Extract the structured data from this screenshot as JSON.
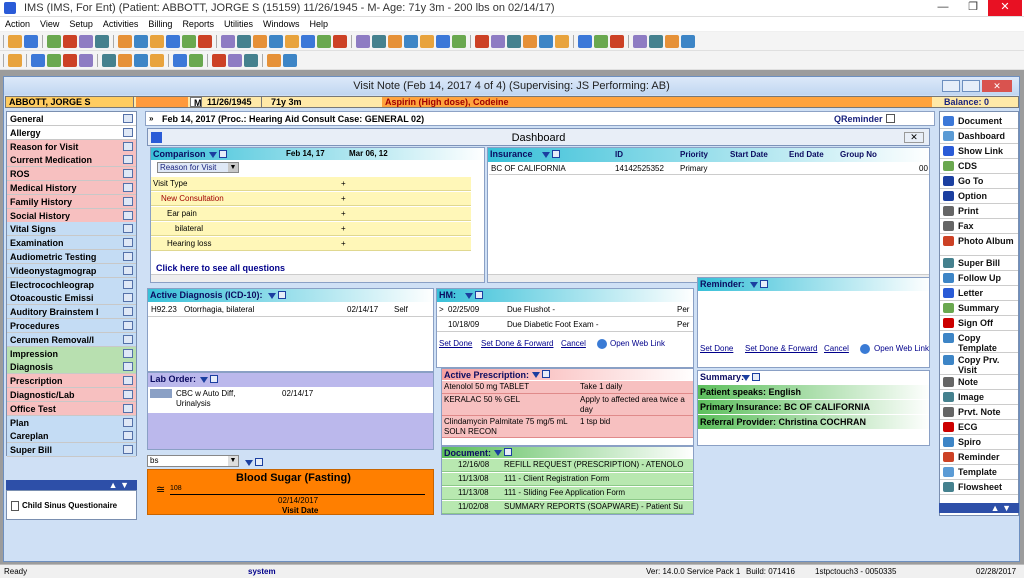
{
  "window": {
    "title": "IMS (IMS, For Ent)    (Patient: ABBOTT, JORGE S (15159) 11/26/1945 - M- Age: 71y 3m  - 200 lbs on 02/14/17)"
  },
  "menu": [
    "Action",
    "View",
    "Setup",
    "Activities",
    "Billing",
    "Reports",
    "Utilities",
    "Windows",
    "Help"
  ],
  "child": {
    "title": "Visit Note (Feb 14, 2017   4 of 4) (Supervising: JS Performing: AB)"
  },
  "patient": {
    "name": "ABBOTT, JORGE S",
    "sex": "M",
    "dob": "11/26/1945",
    "age": "71y 3m",
    "allergies": "Aspirin (High dose), Codeine",
    "balance": "Balance: 0"
  },
  "visit_bar": {
    "text": "Feb 14, 2017  (Proc.: Hearing Aid Consult  Case: GENERAL 02)",
    "qreminder": "QReminder"
  },
  "dashboard": {
    "title": "Dashboard"
  },
  "nav": [
    {
      "label": "General",
      "color": "#ffffff"
    },
    {
      "label": "Allergy",
      "color": "#ffffff"
    },
    {
      "label": "Reason for Visit",
      "color": "#f7c0c0"
    },
    {
      "label": "Current Medication",
      "color": "#f7c0c0"
    },
    {
      "label": "ROS",
      "color": "#f7c0c0"
    },
    {
      "label": "Medical History",
      "color": "#f7c0c0"
    },
    {
      "label": "Family History",
      "color": "#f7c0c0"
    },
    {
      "label": "Social History",
      "color": "#f7c0c0"
    },
    {
      "label": "Vital Signs",
      "color": "#c4dcf4"
    },
    {
      "label": "Examination",
      "color": "#c4dcf4"
    },
    {
      "label": "Audiometric Testing",
      "color": "#c4dcf4"
    },
    {
      "label": "Videonystagmograp",
      "color": "#c4dcf4"
    },
    {
      "label": "Electrocochleograp",
      "color": "#c4dcf4"
    },
    {
      "label": "Otoacoustic Emissi",
      "color": "#c4dcf4"
    },
    {
      "label": "Auditory Brainstem I",
      "color": "#c4dcf4"
    },
    {
      "label": "Procedures",
      "color": "#c4dcf4"
    },
    {
      "label": "Cerumen Removal/I",
      "color": "#c4dcf4"
    },
    {
      "label": "Impression",
      "color": "#b8e0b0"
    },
    {
      "label": "Diagnosis",
      "color": "#b8e0b0"
    },
    {
      "label": "Prescription",
      "color": "#f7c0c0"
    },
    {
      "label": "Diagnostic/Lab",
      "color": "#f7c0c0"
    },
    {
      "label": "Office Test",
      "color": "#f7c0c0"
    },
    {
      "label": "Plan",
      "color": "#c4dcf4"
    },
    {
      "label": "Careplan",
      "color": "#c4dcf4"
    },
    {
      "label": "Super Bill",
      "color": "#c4dcf4"
    }
  ],
  "questionnaire": "Child Sinus Questionaire",
  "right_nav": [
    {
      "label": "Document",
      "icon": "document-icon"
    },
    {
      "label": "Dashboard",
      "icon": "dashboard-icon"
    },
    {
      "label": "Show Link",
      "icon": "link-icon"
    },
    {
      "label": "CDS",
      "icon": "cds-icon"
    },
    {
      "label": "Go To",
      "icon": "goto-icon"
    },
    {
      "label": "Option",
      "icon": "option-icon"
    },
    {
      "label": "Print",
      "icon": "print-icon"
    },
    {
      "label": "Fax",
      "icon": "fax-icon"
    },
    {
      "label": "Photo Album",
      "icon": "photo-icon"
    },
    {
      "label": "Super Bill",
      "icon": "superbill-icon"
    },
    {
      "label": "Follow Up",
      "icon": "followup-icon"
    },
    {
      "label": "Letter",
      "icon": "letter-icon"
    },
    {
      "label": "Summary",
      "icon": "summary-icon"
    },
    {
      "label": "Sign Off",
      "icon": "signoff-icon"
    },
    {
      "label": "Copy Template",
      "icon": "copy-icon"
    },
    {
      "label": "Copy Prv. Visit",
      "icon": "copy-visit-icon"
    },
    {
      "label": "Note",
      "icon": "note-icon"
    },
    {
      "label": "Image",
      "icon": "image-icon"
    },
    {
      "label": "Prvt. Note",
      "icon": "private-note-icon"
    },
    {
      "label": "ECG",
      "icon": "ecg-icon"
    },
    {
      "label": "Spiro",
      "icon": "spiro-icon"
    },
    {
      "label": "Reminder",
      "icon": "reminder-icon"
    },
    {
      "label": "Template",
      "icon": "template-icon"
    },
    {
      "label": "Flowsheet",
      "icon": "flowsheet-icon"
    }
  ],
  "comparison": {
    "header": "Comparison",
    "col1": "Feb 14, 17",
    "col2": "Mar 06, 12",
    "select": "Reason for Visit",
    "rows": [
      {
        "label": "Visit Type",
        "v1": "+"
      },
      {
        "label": "New Consultation",
        "v1": "+"
      },
      {
        "label": "Ear pain",
        "v1": "+"
      },
      {
        "label": "bilateral",
        "v1": "+"
      },
      {
        "label": "Hearing loss",
        "v1": "+"
      }
    ],
    "see_all": "Click here to see all questions"
  },
  "insurance": {
    "headers": [
      "Insurance",
      "ID",
      "Priority",
      "Start Date",
      "End Date",
      "Group No"
    ],
    "row": [
      "BC OF CALIFORNIA",
      "14142525352",
      "Primary",
      "",
      "",
      "",
      "00"
    ]
  },
  "diagnosis": {
    "header": "Active Diagnosis (ICD-10):",
    "row": [
      "H92.23",
      "Otorrhagia, bilateral",
      "02/14/17",
      "Self"
    ]
  },
  "hm": {
    "header": "HM:",
    "rows": [
      [
        "02/25/09",
        "Due Flushot  -",
        "Per"
      ],
      [
        "10/18/09",
        "Due Diabetic Foot Exam  -",
        "Per"
      ]
    ],
    "links": [
      "Set Done",
      "Set Done & Forward",
      "Cancel",
      "Open Web Link"
    ]
  },
  "reminder": {
    "header": "Reminder:",
    "links": [
      "Set Done",
      "Set Done & Forward",
      "Cancel",
      "Open Web Link"
    ]
  },
  "lab": {
    "header": "Lab Order:",
    "row": [
      "CBC w Auto Diff, Urinalysis",
      "02/14/17"
    ]
  },
  "prescription": {
    "header": "Active Prescription:",
    "rows": [
      [
        "Atenolol 50 mg TABLET",
        "Take 1 daily"
      ],
      [
        "KERALAC 50 % GEL",
        "Apply to affected area twice a day"
      ],
      [
        "Clindamycin Palmitate 75 mg/5 mL SOLN RECON",
        "1 tsp bid"
      ]
    ]
  },
  "summary": {
    "header": "Summary:",
    "items": [
      "Patient speaks: English",
      "Primary Insurance: BC OF CALIFORNIA",
      "Referral Provider: Christina COCHRAN"
    ]
  },
  "document": {
    "header": "Document:",
    "rows": [
      [
        "12/16/08",
        "REFILL REQUEST (PRESCRIPTION) - ATENOLO"
      ],
      [
        "11/13/08",
        "111 - Client Registration Form"
      ],
      [
        "11/13/08",
        "111 - Sliding Fee Application Form"
      ],
      [
        "11/02/08",
        "SUMMARY REPORTS (SOAPWARE) - Patient Su"
      ]
    ]
  },
  "flowsheet": {
    "select": "bs",
    "title": "Blood Sugar (Fasting)",
    "value": "108",
    "date": "02/14/2017",
    "footer": "Visit Date"
  },
  "status": {
    "ready": "Ready",
    "user": "system",
    "version": "Ver: 14.0.0 Service Pack 1",
    "build": "Build: 071416",
    "host": "1stpctouch3 - 0050335",
    "date": "02/28/2017"
  },
  "colors": {
    "nav_header_teal": "#38c0d8",
    "pink_row": "#f7c0c0",
    "yellow_row": "#fff7b8",
    "green_row": "#5cbf5c",
    "flowsheet_orange": "#ff7f00"
  }
}
